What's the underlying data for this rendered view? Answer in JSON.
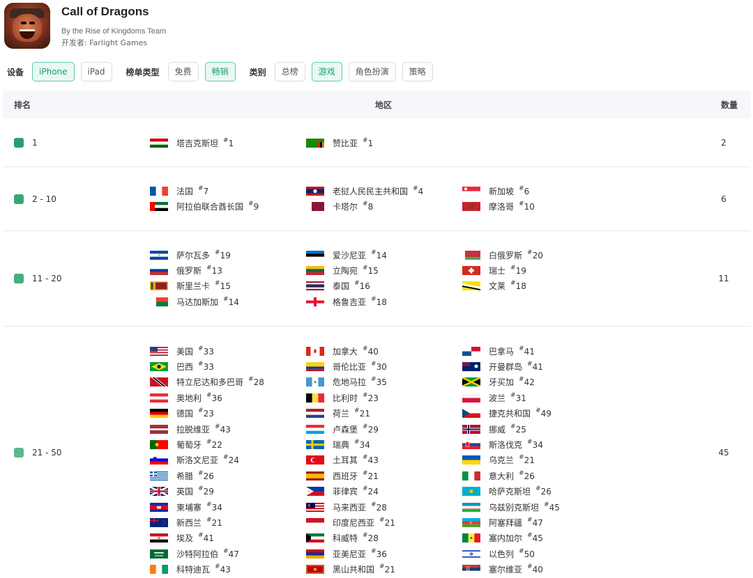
{
  "app": {
    "title": "Call of Dragons",
    "subtitle": "By the Rise of Kingdoms Team",
    "developer": "开发者: Farlight Games"
  },
  "filters": {
    "device_label": "设备",
    "devices": [
      "iPhone",
      "iPad"
    ],
    "device_selected": "iPhone",
    "chart_type_label": "榜单类型",
    "chart_types": [
      "免费",
      "畅销"
    ],
    "chart_type_selected": "畅销",
    "category_label": "类别",
    "categories": [
      "总榜",
      "游戏",
      "角色扮演",
      "策略"
    ],
    "category_selected": "游戏"
  },
  "table": {
    "headers": {
      "rank": "排名",
      "region": "地区",
      "count": "数量"
    },
    "rows": [
      {
        "rank": "1",
        "count": "2",
        "swatch": "#2e9b6f",
        "regions": [
          {
            "name": "塔吉克斯坦",
            "rank": "1",
            "flag": "tajikistan-flag"
          },
          {
            "name": "赞比亚",
            "rank": "1",
            "flag": "zambia-flag"
          }
        ]
      },
      {
        "rank": "2 - 10",
        "count": "6",
        "swatch": "#3aa676",
        "regions": [
          {
            "name": "法国",
            "rank": "7",
            "flag": "france-flag"
          },
          {
            "name": "老挝人民民主共和国",
            "rank": "4",
            "flag": "laos-flag"
          },
          {
            "name": "新加坡",
            "rank": "6",
            "flag": "singapore-flag"
          },
          {
            "name": "阿拉伯联合酋长国",
            "rank": "9",
            "flag": "uae-flag"
          },
          {
            "name": "卡塔尔",
            "rank": "8",
            "flag": "qatar-flag"
          },
          {
            "name": "摩洛哥",
            "rank": "10",
            "flag": "morocco-flag"
          }
        ]
      },
      {
        "rank": "11 - 20",
        "count": "11",
        "swatch": "#45ae80",
        "regions": [
          {
            "name": "萨尔瓦多",
            "rank": "19",
            "flag": "el-salvador-flag"
          },
          {
            "name": "爱沙尼亚",
            "rank": "14",
            "flag": "estonia-flag"
          },
          {
            "name": "白俄罗斯",
            "rank": "20",
            "flag": "belarus-flag"
          },
          {
            "name": "俄罗斯",
            "rank": "13",
            "flag": "russia-flag"
          },
          {
            "name": "立陶宛",
            "rank": "15",
            "flag": "lithuania-flag"
          },
          {
            "name": "瑞士",
            "rank": "19",
            "flag": "switzerland-flag"
          },
          {
            "name": "斯里兰卡",
            "rank": "15",
            "flag": "sri-lanka-flag"
          },
          {
            "name": "泰国",
            "rank": "16",
            "flag": "thailand-flag"
          },
          {
            "name": "文莱",
            "rank": "18",
            "flag": "brunei-flag"
          },
          {
            "name": "马达加斯加",
            "rank": "14",
            "flag": "madagascar-flag"
          },
          {
            "name": "格鲁吉亚",
            "rank": "18",
            "flag": "georgia-flag"
          }
        ]
      },
      {
        "rank": "21 - 50",
        "count": "45",
        "swatch": "#5cb88e",
        "regions": [
          {
            "name": "美国",
            "rank": "33",
            "flag": "usa-flag"
          },
          {
            "name": "加拿大",
            "rank": "40",
            "flag": "canada-flag"
          },
          {
            "name": "巴拿马",
            "rank": "41",
            "flag": "panama-flag"
          },
          {
            "name": "巴西",
            "rank": "33",
            "flag": "brazil-flag"
          },
          {
            "name": "哥伦比亚",
            "rank": "30",
            "flag": "colombia-flag"
          },
          {
            "name": "开曼群岛",
            "rank": "41",
            "flag": "cayman-islands-flag"
          },
          {
            "name": "特立尼达和多巴哥",
            "rank": "28",
            "flag": "trinidad-tobago-flag"
          },
          {
            "name": "危地马拉",
            "rank": "35",
            "flag": "guatemala-flag"
          },
          {
            "name": "牙买加",
            "rank": "42",
            "flag": "jamaica-flag"
          },
          {
            "name": "奥地利",
            "rank": "36",
            "flag": "austria-flag"
          },
          {
            "name": "比利时",
            "rank": "23",
            "flag": "belgium-flag"
          },
          {
            "name": "波兰",
            "rank": "31",
            "flag": "poland-flag"
          },
          {
            "name": "德国",
            "rank": "23",
            "flag": "germany-flag"
          },
          {
            "name": "荷兰",
            "rank": "21",
            "flag": "netherlands-flag"
          },
          {
            "name": "捷克共和国",
            "rank": "49",
            "flag": "czech-flag"
          },
          {
            "name": "拉脱维亚",
            "rank": "43",
            "flag": "latvia-flag"
          },
          {
            "name": "卢森堡",
            "rank": "29",
            "flag": "luxembourg-flag"
          },
          {
            "name": "挪威",
            "rank": "25",
            "flag": "norway-flag"
          },
          {
            "name": "葡萄牙",
            "rank": "22",
            "flag": "portugal-flag"
          },
          {
            "name": "瑞典",
            "rank": "34",
            "flag": "sweden-flag"
          },
          {
            "name": "斯洛伐克",
            "rank": "34",
            "flag": "slovakia-flag"
          },
          {
            "name": "斯洛文尼亚",
            "rank": "24",
            "flag": "slovenia-flag"
          },
          {
            "name": "土耳其",
            "rank": "43",
            "flag": "turkey-flag"
          },
          {
            "name": "乌克兰",
            "rank": "21",
            "flag": "ukraine-flag"
          },
          {
            "name": "希腊",
            "rank": "26",
            "flag": "greece-flag"
          },
          {
            "name": "西班牙",
            "rank": "21",
            "flag": "spain-flag"
          },
          {
            "name": "意大利",
            "rank": "26",
            "flag": "italy-flag"
          },
          {
            "name": "英国",
            "rank": "29",
            "flag": "uk-flag"
          },
          {
            "name": "菲律宾",
            "rank": "24",
            "flag": "philippines-flag"
          },
          {
            "name": "哈萨克斯坦",
            "rank": "26",
            "flag": "kazakhstan-flag"
          },
          {
            "name": "柬埔寨",
            "rank": "34",
            "flag": "cambodia-flag"
          },
          {
            "name": "马来西亚",
            "rank": "28",
            "flag": "malaysia-flag"
          },
          {
            "name": "乌兹别克斯坦",
            "rank": "45",
            "flag": "uzbekistan-flag"
          },
          {
            "name": "新西兰",
            "rank": "21",
            "flag": "new-zealand-flag"
          },
          {
            "name": "印度尼西亚",
            "rank": "21",
            "flag": "indonesia-flag"
          },
          {
            "name": "阿塞拜疆",
            "rank": "47",
            "flag": "azerbaijan-flag"
          },
          {
            "name": "埃及",
            "rank": "41",
            "flag": "egypt-flag"
          },
          {
            "name": "科威特",
            "rank": "28",
            "flag": "kuwait-flag"
          },
          {
            "name": "塞内加尔",
            "rank": "45",
            "flag": "senegal-flag"
          },
          {
            "name": "沙特阿拉伯",
            "rank": "47",
            "flag": "saudi-arabia-flag"
          },
          {
            "name": "亚美尼亚",
            "rank": "36",
            "flag": "armenia-flag"
          },
          {
            "name": "以色列",
            "rank": "50",
            "flag": "israel-flag"
          },
          {
            "name": "科特迪瓦",
            "rank": "43",
            "flag": "ivory-coast-flag"
          },
          {
            "name": "黑山共和国",
            "rank": "21",
            "flag": "montenegro-flag"
          },
          {
            "name": "塞尔维亚",
            "rank": "40",
            "flag": "serbia-flag"
          }
        ]
      }
    ]
  }
}
